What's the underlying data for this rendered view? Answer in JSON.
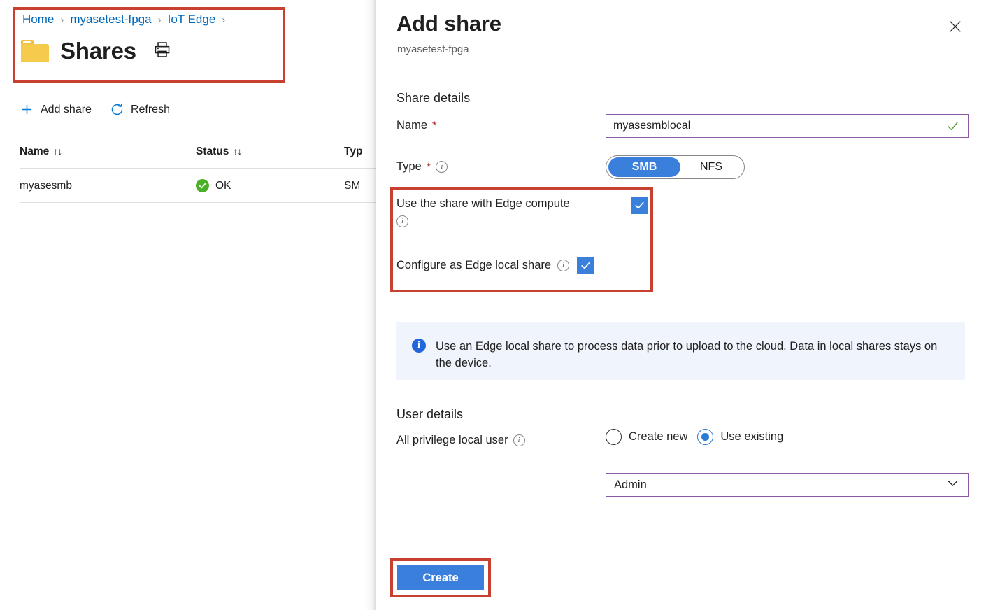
{
  "breadcrumb": {
    "items": [
      {
        "label": "Home"
      },
      {
        "label": "myasetest-fpga"
      },
      {
        "label": "IoT Edge"
      }
    ],
    "separator": "›"
  },
  "page": {
    "title": "Shares",
    "folder_icon": "folder-icon",
    "print_icon": "printer-icon"
  },
  "commandbar": {
    "add_share": "Add share",
    "add_icon": "plus-icon",
    "refresh": "Refresh",
    "refresh_icon": "refresh-icon"
  },
  "table": {
    "columns": [
      {
        "label": "Name",
        "sort_icon": "sort-icon"
      },
      {
        "label": "Status",
        "sort_icon": "sort-icon"
      },
      {
        "label": "Typ",
        "sort_icon": ""
      }
    ],
    "rows": [
      {
        "name": "myasesmb",
        "status": "OK",
        "status_icon": "check-circle-icon",
        "type": "SM"
      }
    ]
  },
  "panel": {
    "title": "Add share",
    "subtitle": "myasetest-fpga",
    "close_icon": "close-icon",
    "share_details": {
      "heading": "Share details",
      "name": {
        "label": "Name",
        "required_marker": "*",
        "value": "myasesmblocal",
        "placeholder": "",
        "valid_icon": "checkmark-icon"
      },
      "type": {
        "label": "Type",
        "required_marker": "*",
        "info_icon": "info-icon",
        "options": [
          "SMB",
          "NFS"
        ],
        "selected": "SMB"
      },
      "checkboxes": [
        {
          "label": "Use the share with Edge compute",
          "info_icon": "info-icon",
          "checked": true
        },
        {
          "label": "Configure as Edge local share",
          "info_icon": "info-icon",
          "checked": true
        }
      ]
    },
    "info_banner": {
      "icon": "info-filled-icon",
      "text": "Use an Edge local share to process data prior to upload to the cloud. Data in local shares stays on the device."
    },
    "user_details": {
      "heading": "User details",
      "privilege": {
        "label": "All privilege local user",
        "info_icon": "info-icon",
        "options": [
          "Create new",
          "Use existing"
        ],
        "selected": "Use existing"
      },
      "user_select": {
        "value": "Admin",
        "chevron_icon": "chevron-down-icon"
      }
    },
    "footer": {
      "create_label": "Create"
    }
  },
  "colors": {
    "highlight_red": "#c8402f",
    "accent_blue": "#3b7fdd",
    "link_blue": "#0067b8",
    "field_border_purple": "#8b5aa6",
    "status_green": "#4caf28",
    "banner_bg": "#eff4fd",
    "required_red": "#a4262c"
  }
}
